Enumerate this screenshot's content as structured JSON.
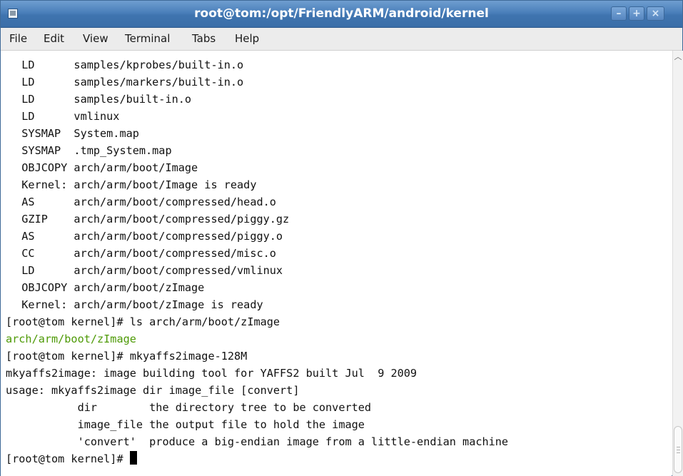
{
  "window": {
    "title": "root@tom:/opt/FriendlyARM/android/kernel",
    "buttons": {
      "minimize": "–",
      "maximize": "+",
      "close": "×"
    }
  },
  "menubar": {
    "items": [
      "File",
      "Edit",
      "View",
      "Terminal",
      "Tabs",
      "Help"
    ]
  },
  "terminal": {
    "lines": [
      "  LD      samples/kprobes/built-in.o",
      "  LD      samples/markers/built-in.o",
      "  LD      samples/built-in.o",
      "  LD      vmlinux",
      "  SYSMAP  System.map",
      "  SYSMAP  .tmp_System.map",
      "  OBJCOPY arch/arm/boot/Image",
      "  Kernel: arch/arm/boot/Image is ready",
      "  AS      arch/arm/boot/compressed/head.o",
      "  GZIP    arch/arm/boot/compressed/piggy.gz",
      "  AS      arch/arm/boot/compressed/piggy.o",
      "  CC      arch/arm/boot/compressed/misc.o",
      "  LD      arch/arm/boot/compressed/vmlinux",
      "  OBJCOPY arch/arm/boot/zImage",
      "  Kernel: arch/arm/boot/zImage is ready",
      "[root@tom kernel]# ls arch/arm/boot/zImage",
      "arch/arm/boot/zImage",
      "[root@tom kernel]# mkyaffs2image-128M",
      "mkyaffs2image: image building tool for YAFFS2 built Jul  9 2009",
      "usage: mkyaffs2image dir image_file [convert]",
      "           dir        the directory tree to be converted",
      "           image_file the output file to hold the image",
      "           'convert'  produce a big-endian image from a little-endian machine"
    ],
    "prompt": "[root@tom kernel]# ",
    "highlight_color": "#4e9a06"
  },
  "icons": {
    "window": "terminal-icon",
    "scroll_up": "chevron-up-icon"
  }
}
